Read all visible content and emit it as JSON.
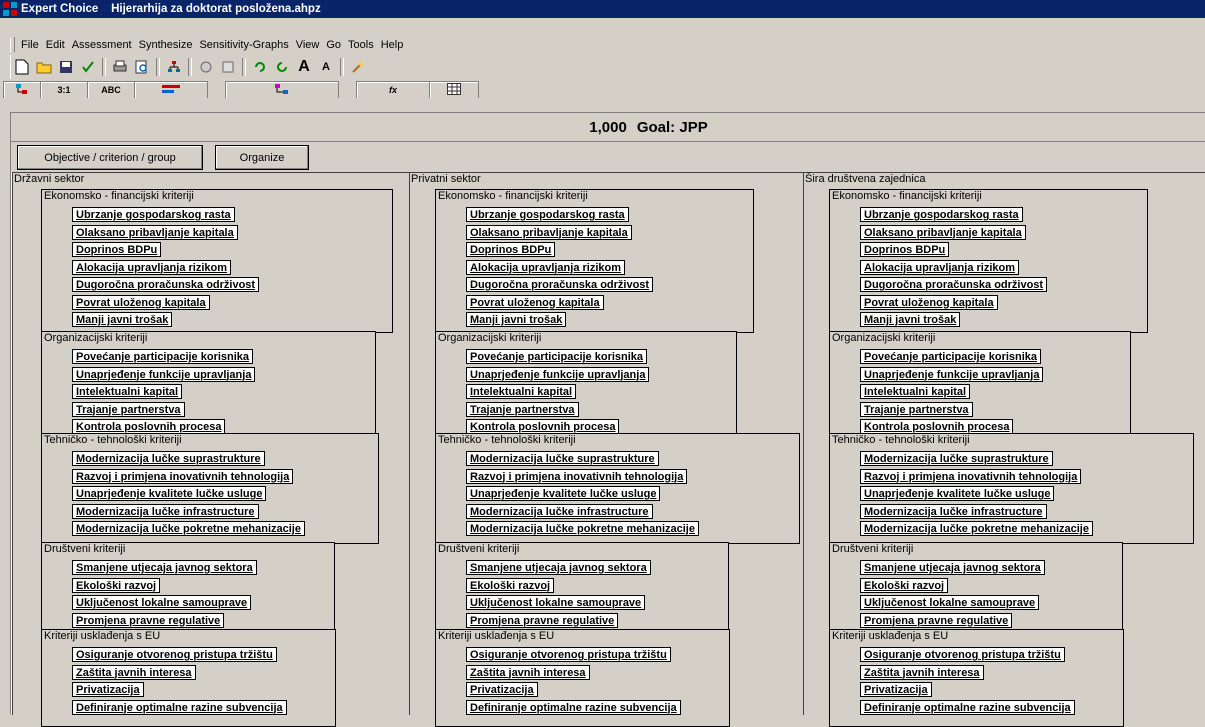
{
  "window": {
    "title": "Expert Choice    Hijerarhija za doktorat posložena.ahpz"
  },
  "menu": [
    "File",
    "Edit",
    "Assessment",
    "Synthesize",
    "Sensitivity-Graphs",
    "View",
    "Go",
    "Tools",
    "Help"
  ],
  "toolbar": [
    "new-file",
    "open-folder",
    "save",
    "check",
    "print",
    "print-preview",
    "tree",
    "paint",
    "model",
    "refresh-green",
    "refresh-green-2",
    "font-larger",
    "font-smaller",
    "tools"
  ],
  "tabs": [
    "",
    "3:1",
    "ABC",
    "",
    "",
    "fx",
    ""
  ],
  "goal": {
    "value": "1,000",
    "label": "Goal: JPP"
  },
  "buttons": {
    "objective": "Objective / criterion / group",
    "organize": "Organize"
  },
  "columns": [
    {
      "title": "Državni sektor",
      "criteria": [
        {
          "name": "Ekonomsko - financijski kriteriji",
          "subs": [
            "Ubrzanje gospodarskog rasta",
            "Olaksano pribavljanje kapitala",
            "Doprinos BDPu",
            "Alokacija upravljanja rizikom",
            "Dugoročna proračunska održivost",
            "Povrat uloženog kapitala",
            "Manji javni trošak"
          ]
        },
        {
          "name": "Organizacijski kriteriji",
          "subs": [
            "Povećanje participacije korisnika",
            "Unaprjeđenje funkcije upravljanja",
            "Intelektualni kapital",
            "Trajanje partnerstva",
            "Kontrola poslovnih procesa"
          ]
        },
        {
          "name": "Tehničko - tehnološki kriteriji",
          "subs": [
            "Modernizacija lučke suprastrukture",
            "Razvoj i primjena inovativnih tehnologija",
            "Unaprjeđenje kvalitete lučke usluge",
            "Modernizacija lučke infrastructure",
            "Modernizacija lučke pokretne mehanizacije"
          ]
        },
        {
          "name": "Društveni kriteriji",
          "subs": [
            "Smanjene utjecaja javnog sektora",
            "Ekološki razvoj",
            "Uključenost lokalne samouprave",
            "Promjena pravne regulative"
          ]
        },
        {
          "name": "Kriteriji usklađenja s EU",
          "subs": [
            "Osiguranje otvorenog pristupa tržištu",
            "Zaštita javnih interesa",
            "Privatizacija",
            "Definiranje optimalne razine subvencija"
          ]
        }
      ]
    },
    {
      "title": "Privatni sektor",
      "criteria": [
        {
          "name": "Ekonomsko - financijski kriteriji",
          "subs": [
            "Ubrzanje gospodarskog rasta",
            "Olaksano pribavljanje kapitala",
            "Doprinos BDPu",
            "Alokacija upravljanja rizikom",
            "Dugoročna proračunska održivost",
            "Povrat uloženog kapitala",
            "Manji javni trošak"
          ]
        },
        {
          "name": "Organizacijski kriteriji",
          "subs": [
            "Povećanje participacije korisnika",
            "Unaprjeđenje funkcije upravljanja",
            "Intelektualni kapital",
            "Trajanje partnerstva",
            "Kontrola poslovnih procesa"
          ]
        },
        {
          "name": "Tehničko - tehnološki kriteriji",
          "subs": [
            "Modernizacija lučke suprastrukture",
            "Razvoj i primjena inovativnih tehnologija",
            "Unaprjeđenje kvalitete lučke usluge",
            "Modernizacija lučke infrastructure",
            "Modernizacija lučke pokretne mehanizacije"
          ]
        },
        {
          "name": "Društveni kriteriji",
          "subs": [
            "Smanjene utjecaja javnog sektora",
            "Ekološki razvoj",
            "Uključenost lokalne samouprave",
            "Promjena pravne regulative"
          ]
        },
        {
          "name": "Kriteriji usklađenja s EU",
          "subs": [
            "Osiguranje otvorenog pristupa tržištu",
            "Zaštita javnih interesa",
            "Privatizacija",
            "Definiranje optimalne razine subvencija"
          ]
        }
      ]
    },
    {
      "title": "Šira društvena zajednica",
      "criteria": [
        {
          "name": "Ekonomsko - financijski kriteriji",
          "subs": [
            "Ubrzanje gospodarskog rasta",
            "Olaksano pribavljanje kapitala",
            "Doprinos BDPu",
            "Alokacija upravljanja rizikom",
            "Dugoročna proračunska održivost",
            "Povrat uloženog kapitala",
            "Manji javni trošak"
          ]
        },
        {
          "name": "Organizacijski kriteriji",
          "subs": [
            "Povećanje participacije korisnika",
            "Unaprjeđenje funkcije upravljanja",
            "Intelektualni kapital",
            "Trajanje partnerstva",
            "Kontrola poslovnih procesa"
          ]
        },
        {
          "name": "Tehničko - tehnološki kriteriji",
          "subs": [
            "Modernizacija lučke suprastrukture",
            "Razvoj i primjena inovativnih tehnologija",
            "Unaprjeđenje kvalitete lučke usluge",
            "Modernizacija lučke infrastructure",
            "Modernizacija lučke pokretne mehanizacije"
          ]
        },
        {
          "name": "Društveni kriteriji",
          "subs": [
            "Smanjene utjecaja javnog sektora",
            "Ekološki razvoj",
            "Uključenost lokalne samouprave",
            "Promjena pravne regulative"
          ]
        },
        {
          "name": "Kriteriji usklađenja s EU",
          "subs": [
            "Osiguranje otvorenog pristupa tržištu",
            "Zaštita javnih interesa",
            "Privatizacija",
            "Definiranje optimalne razine subvencija"
          ]
        }
      ]
    }
  ]
}
